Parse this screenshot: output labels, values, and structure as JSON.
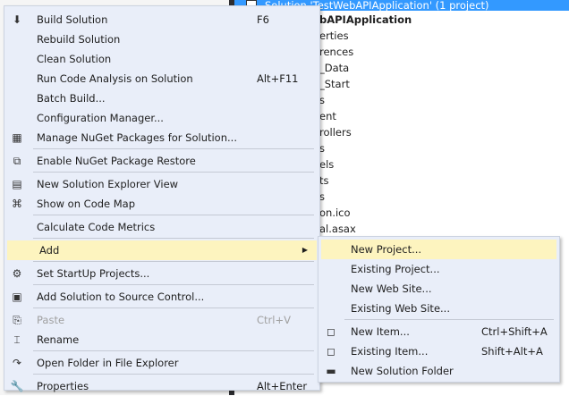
{
  "solution_explorer": {
    "header": "Solution 'TestWebAPIApplication' (1 project)",
    "items": [
      {
        "text": "bAPIApplication",
        "bold": true
      },
      {
        "text": "erties"
      },
      {
        "text": "rences"
      },
      {
        "text": "_Data"
      },
      {
        "text": "_Start"
      },
      {
        "text": "s"
      },
      {
        "text": "ent"
      },
      {
        "text": "rollers"
      },
      {
        "text": "s"
      },
      {
        "text": "els"
      },
      {
        "text": "ts"
      },
      {
        "text": "s"
      },
      {
        "text": "on.ico"
      },
      {
        "text": "al.asax"
      }
    ]
  },
  "context_menu": [
    {
      "label": "Build Solution",
      "shortcut": "F6",
      "icon": "build-icon",
      "glyph": "⬇"
    },
    {
      "label": "Rebuild Solution"
    },
    {
      "label": "Clean Solution"
    },
    {
      "label": "Run Code Analysis on Solution",
      "shortcut": "Alt+F11"
    },
    {
      "label": "Batch Build..."
    },
    {
      "label": "Configuration Manager..."
    },
    {
      "label": "Manage NuGet Packages for Solution...",
      "icon": "nuget-icon",
      "glyph": "▦"
    },
    {
      "sep": true
    },
    {
      "label": "Enable NuGet Package Restore",
      "icon": "package-restore-icon",
      "glyph": "⧉"
    },
    {
      "sep": true
    },
    {
      "label": "New Solution Explorer View",
      "icon": "solution-explorer-view-icon",
      "glyph": "▤"
    },
    {
      "label": "Show on Code Map",
      "icon": "code-map-icon",
      "glyph": "⌘"
    },
    {
      "sep": true
    },
    {
      "label": "Calculate Code Metrics"
    },
    {
      "sep": true
    },
    {
      "label": "Add",
      "submenu": true,
      "highlighted": true
    },
    {
      "sep": true
    },
    {
      "label": "Set StartUp Projects...",
      "icon": "gear-icon",
      "glyph": "⚙"
    },
    {
      "sep": true
    },
    {
      "label": "Add Solution to Source Control...",
      "icon": "source-control-icon",
      "glyph": "▣"
    },
    {
      "sep": true
    },
    {
      "label": "Paste",
      "shortcut": "Ctrl+V",
      "icon": "paste-icon",
      "glyph": "⎘",
      "disabled": true
    },
    {
      "label": "Rename",
      "icon": "rename-icon",
      "glyph": "⌶"
    },
    {
      "sep": true
    },
    {
      "label": "Open Folder in File Explorer",
      "icon": "open-folder-icon",
      "glyph": "↷"
    },
    {
      "sep": true
    },
    {
      "label": "Properties",
      "shortcut": "Alt+Enter",
      "icon": "wrench-icon",
      "glyph": "🔧"
    }
  ],
  "add_submenu": [
    {
      "label": "New Project...",
      "highlighted": true
    },
    {
      "label": "Existing Project..."
    },
    {
      "label": "New Web Site..."
    },
    {
      "label": "Existing Web Site..."
    },
    {
      "sep": true
    },
    {
      "label": "New Item...",
      "shortcut": "Ctrl+Shift+A",
      "icon": "new-item-icon",
      "glyph": "◻"
    },
    {
      "label": "Existing Item...",
      "shortcut": "Shift+Alt+A",
      "icon": "existing-item-icon",
      "glyph": "◻"
    },
    {
      "label": "New Solution Folder",
      "icon": "solution-folder-icon",
      "glyph": "▬"
    }
  ],
  "submenu_arrow": "▶"
}
